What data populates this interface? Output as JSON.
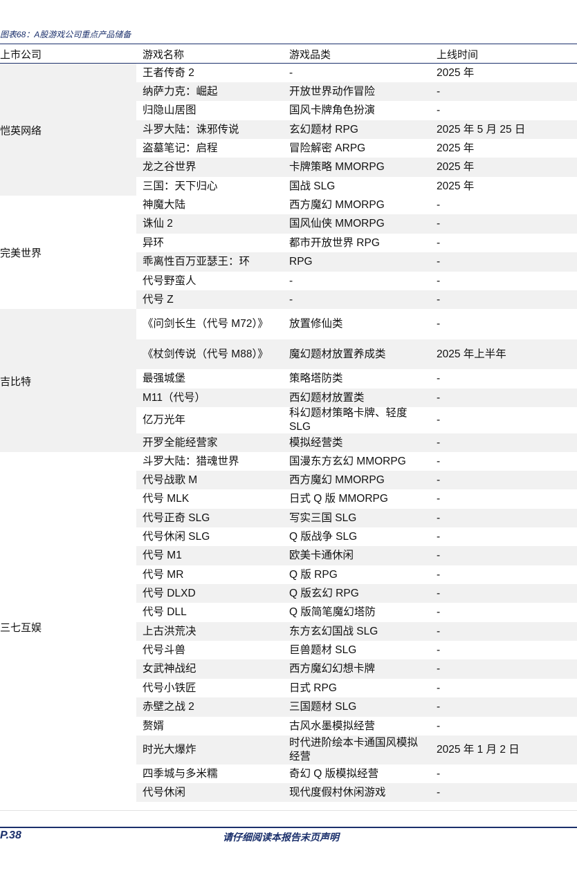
{
  "caption": "图表68：A股游戏公司重点产品储备",
  "header": {
    "company": "上市公司",
    "game": "游戏名称",
    "genre": "游戏品类",
    "launch": "上线时间"
  },
  "groups": [
    {
      "company": "恺英网络",
      "rows": [
        [
          "王者传奇 2",
          "-",
          "2025 年"
        ],
        [
          "纳萨力克：崛起",
          "开放世界动作冒险",
          "-"
        ],
        [
          "归隐山居图",
          "国风卡牌角色扮演",
          "-"
        ],
        [
          "斗罗大陆：诛邪传说",
          "玄幻题材 RPG",
          "2025 年 5 月 25 日"
        ],
        [
          "盗墓笔记：启程",
          "冒险解密 ARPG",
          "2025 年"
        ],
        [
          "龙之谷世界",
          "卡牌策略 MMORPG",
          "2025 年"
        ],
        [
          "三国：天下归心",
          "国战 SLG",
          "2025 年"
        ]
      ]
    },
    {
      "company": "完美世界",
      "rows": [
        [
          "神魔大陆",
          "西方魔幻 MMORPG",
          "-"
        ],
        [
          "诛仙 2",
          "国风仙侠 MMORPG",
          "-"
        ],
        [
          "异环",
          "都市开放世界 RPG",
          "-"
        ],
        [
          "乖离性百万亚瑟王：环",
          "RPG",
          "-"
        ],
        [
          "代号野蛮人",
          "-",
          "-"
        ],
        [
          "代号 Z",
          "-",
          "-"
        ]
      ]
    },
    {
      "company": "吉比特",
      "rows": [
        [
          "《问剑长生（代号 M72）》",
          "放置修仙类",
          "-"
        ],
        [
          "《杖剑传说（代号 M88）》",
          "魔幻题材放置养成类",
          "2025 年上半年"
        ],
        [
          "最强城堡",
          "策略塔防类",
          "-"
        ],
        [
          "M11（代号）",
          "西幻题材放置类",
          "-"
        ],
        [
          "亿万光年",
          "科幻题材策略卡牌、轻度 SLG",
          "-"
        ],
        [
          "开罗全能经营家",
          "模拟经营类",
          "-"
        ]
      ]
    },
    {
      "company": "三七互娱",
      "rows": [
        [
          "斗罗大陆：猎魂世界",
          "国漫东方玄幻 MMORPG",
          "-"
        ],
        [
          "代号战歌 M",
          "西方魔幻 MMORPG",
          "-"
        ],
        [
          "代号 MLK",
          "日式 Q 版 MMORPG",
          "-"
        ],
        [
          "代号正奇 SLG",
          "写实三国 SLG",
          "-"
        ],
        [
          "代号休闲 SLG",
          "Q 版战争 SLG",
          "-"
        ],
        [
          "代号 M1",
          "欧美卡通休闲",
          "-"
        ],
        [
          "代号 MR",
          "Q 版 RPG",
          "-"
        ],
        [
          "代号 DLXD",
          "Q 版玄幻 RPG",
          "-"
        ],
        [
          "代号 DLL",
          "Q 版简笔魔幻塔防",
          "-"
        ],
        [
          "上古洪荒决",
          "东方玄幻国战 SLG",
          "-"
        ],
        [
          "代号斗兽",
          "巨兽题材 SLG",
          "-"
        ],
        [
          "女武神战纪",
          "西方魔幻幻想卡牌",
          "-"
        ],
        [
          "代号小铁匠",
          "日式 RPG",
          "-"
        ],
        [
          "赤壁之战 2",
          "三国题材 SLG",
          "-"
        ],
        [
          "赘婿",
          "古风水墨模拟经营",
          "-"
        ],
        [
          "时光大爆炸",
          "时代进阶绘本卡通国风模拟经营",
          "2025 年 1 月 2 日"
        ],
        [
          "四季城与多米糯",
          "奇幻 Q 版模拟经营",
          "-"
        ],
        [
          "代号休闲",
          "现代度假村休闲游戏",
          "-"
        ]
      ]
    }
  ],
  "footer": {
    "page": "P.38",
    "disclaimer": "请仔细阅读本报告末页声明"
  }
}
